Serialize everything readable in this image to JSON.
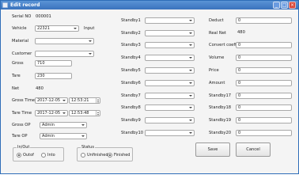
{
  "window": {
    "title": "Edit record"
  },
  "left": {
    "serial_no": {
      "label": "Serial NO",
      "value": "000001"
    },
    "vehicle": {
      "label": "Vehicle",
      "value": "22321",
      "suffix": "Input"
    },
    "material": {
      "label": "Material",
      "value": ""
    },
    "customer": {
      "label": "Customer",
      "value": ""
    },
    "gross": {
      "label": "Gross",
      "value": "710"
    },
    "tare": {
      "label": "Tare",
      "value": "230"
    },
    "net": {
      "label": "Net",
      "value": "480"
    },
    "gross_time": {
      "label": "Gross Time",
      "date": "2017-12-05",
      "time": "12:53:21"
    },
    "tare_time": {
      "label": "Tare Time",
      "date": "2017-12-05",
      "time": "12:53:48"
    },
    "gross_op": {
      "label": "Gross OP",
      "value": "Admin"
    },
    "tare_op": {
      "label": "Tare OP",
      "value": "Admin"
    }
  },
  "standby": [
    {
      "label": "Standby1",
      "value": ""
    },
    {
      "label": "Standby2",
      "value": ""
    },
    {
      "label": "Standby3",
      "value": ""
    },
    {
      "label": "Standby4",
      "value": ""
    },
    {
      "label": "Standby5",
      "value": ""
    },
    {
      "label": "Standby6",
      "value": ""
    },
    {
      "label": "Standby7",
      "value": ""
    },
    {
      "label": "Standby8",
      "value": ""
    },
    {
      "label": "Standby9",
      "value": ""
    },
    {
      "label": "Standby10",
      "value": ""
    }
  ],
  "right": {
    "deduct": {
      "label": "Deduct",
      "value": "0"
    },
    "real_net": {
      "label": "Real Net",
      "value": "480"
    },
    "convert_coefficient": {
      "label": "Convert coefficie",
      "value": "0"
    },
    "volume": {
      "label": "Volume",
      "value": "0"
    },
    "price": {
      "label": "Price",
      "value": "0"
    },
    "amount": {
      "label": "Amount",
      "value": "0"
    },
    "standby17": {
      "label": "Standby17",
      "value": "0"
    },
    "standby18": {
      "label": "Standby18",
      "value": "0"
    },
    "standby19": {
      "label": "Standby19",
      "value": "0"
    },
    "standby20": {
      "label": "Standby20",
      "value": "0"
    }
  },
  "in_out": {
    "title": "In/Out",
    "options": [
      "Outof",
      "Into"
    ],
    "selected": "Outof"
  },
  "status": {
    "title": "Status",
    "options": [
      "Unfinished",
      "Finished"
    ],
    "selected": "Finished"
  },
  "buttons": {
    "save": "Save",
    "cancel": "Cancel"
  },
  "colors": {
    "titlebar": "#3a72bd",
    "close": "#d9483a",
    "background": "#f4f4f4"
  }
}
